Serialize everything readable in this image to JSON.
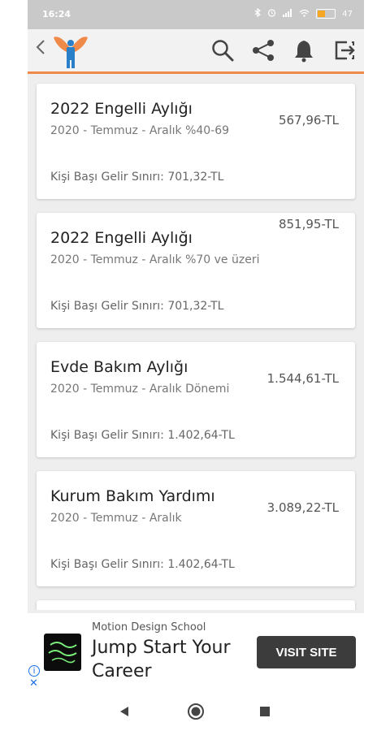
{
  "status_bar": {
    "time": "16:24",
    "battery_text": "47",
    "battery_level": 0.47,
    "icons": [
      "bluetooth-icon",
      "alarm-icon",
      "signal-icon",
      "wifi-icon",
      "battery-icon"
    ]
  },
  "app_bar": {
    "back_icon": "chevron-left-icon",
    "logo": "winged-person-logo",
    "actions": [
      "search-icon",
      "share-icon",
      "bell-icon",
      "logout-icon"
    ],
    "accent_color": "#f08a4b"
  },
  "cards": [
    {
      "title": "2022 Engelli Aylığı",
      "subtitle": "2020 - Temmuz - Aralık %40-69",
      "amount": "567,96-TL",
      "limit": "Kişi Başı Gelir Sınırı: 701,32-TL"
    },
    {
      "title": "2022 Engelli Aylığı",
      "subtitle": "2020 - Temmuz - Aralık %70 ve üzeri",
      "amount": "851,95-TL",
      "limit": "Kişi Başı Gelir Sınırı: 701,32-TL"
    },
    {
      "title": "Evde Bakım Aylığı",
      "subtitle": "2020 - Temmuz - Aralık Dönemi",
      "amount": "1.544,61-TL",
      "limit": "Kişi Başı Gelir Sınırı: 1.402,64-TL"
    },
    {
      "title": "Kurum Bakım Yardımı",
      "subtitle": "2020 - Temmuz - Aralık",
      "amount": "3.089,22-TL",
      "limit": "Kişi Başı Gelir Sınırı: 1.402,64-TL"
    }
  ],
  "ad": {
    "advertiser": "Motion Design School",
    "headline": "Jump Start Your Career",
    "cta": "VISIT SITE"
  },
  "nav_bar": {
    "buttons": [
      "back-triangle-icon",
      "home-circle-icon",
      "recents-square-icon"
    ]
  }
}
